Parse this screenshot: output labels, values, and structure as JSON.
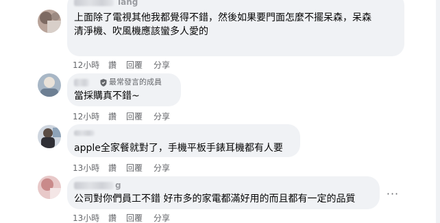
{
  "comments": [
    {
      "author_partial": "lang",
      "badge": "",
      "text": "上面除了電視其他我都覺得不錯，然後如果要門面怎麼不擺呆森，呆森\n清淨機、吹風機應該蠻多人愛的",
      "time": "12小時",
      "like": "讚",
      "reply": "回覆",
      "share": "分享"
    },
    {
      "author_partial": "",
      "badge": "最常發言的成員",
      "text": "當採購真不錯~",
      "time": "12小時",
      "like": "讚",
      "reply": "回覆",
      "share": "分享"
    },
    {
      "author_partial": "",
      "badge": "",
      "text": "apple全家餐就對了，手機平板手錶耳機都有人要",
      "time": "13小時",
      "like": "讚",
      "reply": "回覆",
      "share": "分享"
    },
    {
      "author_partial": "g",
      "badge": "",
      "text": "公司對你們員工不錯 好市多的家電都滿好用的而且都有一定的品質",
      "time": "13小時",
      "like": "讚",
      "reply": "回覆",
      "share": "分享",
      "more": "···"
    }
  ],
  "colors": {
    "bubble": "#f0f2f5",
    "meta": "#65676b",
    "text": "#050505"
  },
  "icons": [
    "shield-icon",
    "more-options-icon"
  ]
}
